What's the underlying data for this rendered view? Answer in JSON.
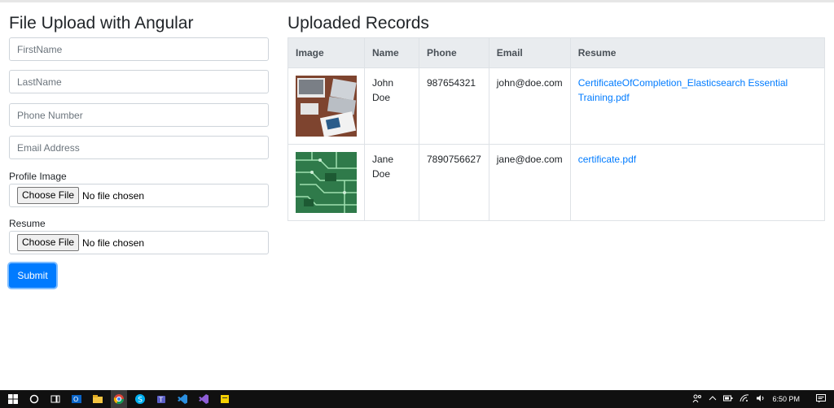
{
  "form": {
    "title": "File Upload with Angular",
    "first_name_placeholder": "FirstName",
    "last_name_placeholder": "LastName",
    "phone_placeholder": "Phone Number",
    "email_placeholder": "Email Address",
    "profile_image_label": "Profile Image",
    "resume_label": "Resume",
    "choose_file_label": "Choose File",
    "no_file_text": "No file chosen",
    "submit_label": "Submit"
  },
  "records": {
    "title": "Uploaded Records",
    "headers": [
      "Image",
      "Name",
      "Phone",
      "Email",
      "Resume"
    ],
    "rows": [
      {
        "name": "John Doe",
        "phone": "987654321",
        "email": "john@doe.com",
        "resume": "CertificateOfCompletion_Elasticsearch Essential Training.pdf",
        "image": "desk-laptop-photo"
      },
      {
        "name": "Jane Doe",
        "phone": "7890756627",
        "email": "jane@doe.com",
        "resume": "certificate.pdf",
        "image": "circuit-board-photo"
      }
    ]
  },
  "taskbar": {
    "icons": [
      "windows-start-icon",
      "cortana-icon",
      "task-view-icon",
      "outlook-icon",
      "file-explorer-icon",
      "chrome-icon",
      "skype-icon",
      "teams-icon",
      "vscode-icon",
      "visual-studio-icon",
      "sticky-notes-icon"
    ],
    "time": "6:50 PM"
  }
}
